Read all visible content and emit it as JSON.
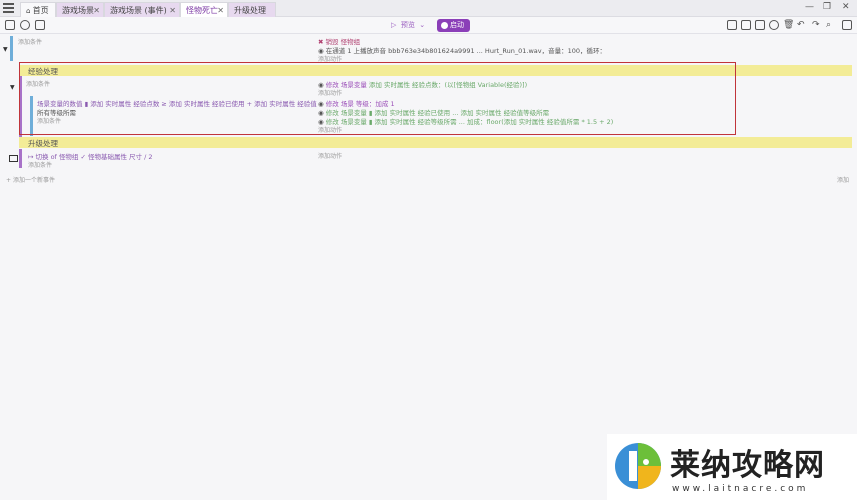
{
  "tabs": [
    {
      "label": "首页",
      "closable": false
    },
    {
      "label": "游戏场景",
      "closable": true
    },
    {
      "label": "游戏场景 (事件)",
      "closable": true
    },
    {
      "label": "怪物死亡",
      "closable": true
    },
    {
      "label": "升级处理",
      "closable": false
    }
  ],
  "toolbar": {
    "preview_label": "预览",
    "run_label": "启动"
  },
  "events": {
    "add_condition": "添加条件",
    "add_action": "添加动作",
    "add_event": "添加一个新事件",
    "add_right": "添加",
    "row1_action_1": "✖ 销毁 怪物组",
    "row1_action_2": "在通道 1 上播放声音 bbb763e34b801624a9991 ... Hurt_Run_01.wav，音量：100，循环：",
    "group_title": "经验处理",
    "group_action_1": "修改 场景变量 ",
    "group_action_1b": "添加 实时属性 经验点数：(以[怪物组 Variable(经验)])",
    "sub_condition": "场景变量的数值 ▮ 添加 实时属性 经验点数 ≥ 添加 实时属性 经验已使用 + 添加 实时属性 经验值",
    "sub_condition_2": "所有等级所需",
    "sub_action_1": "修改 场景 等级：加成 1",
    "sub_action_2": "修改 场景变量 ▮ 添加 实时属性 经验已使用 ... 添加 实时属性 经验值等级所需",
    "sub_action_3": "修改 场景变量 ▮ 添加 实时属性 经验等级所需 ... 加成：floor(添加 实时属性 经验值所需 * 1.5 + 2)",
    "group2_title": "升级处理",
    "row3_condition": "↦ 切换 of 怪物组 ✓ 怪物基础属性 尺寸 / 2"
  },
  "watermark": {
    "title": "莱纳攻略网",
    "url": "www.laitnacre.com"
  },
  "colors": {
    "accent": "#8b3fb8",
    "group_bg": "#f3ec97",
    "event_bar_blue": "#6faed9",
    "event_bar_purple": "#a872c8",
    "highlight": "#c0343a"
  }
}
